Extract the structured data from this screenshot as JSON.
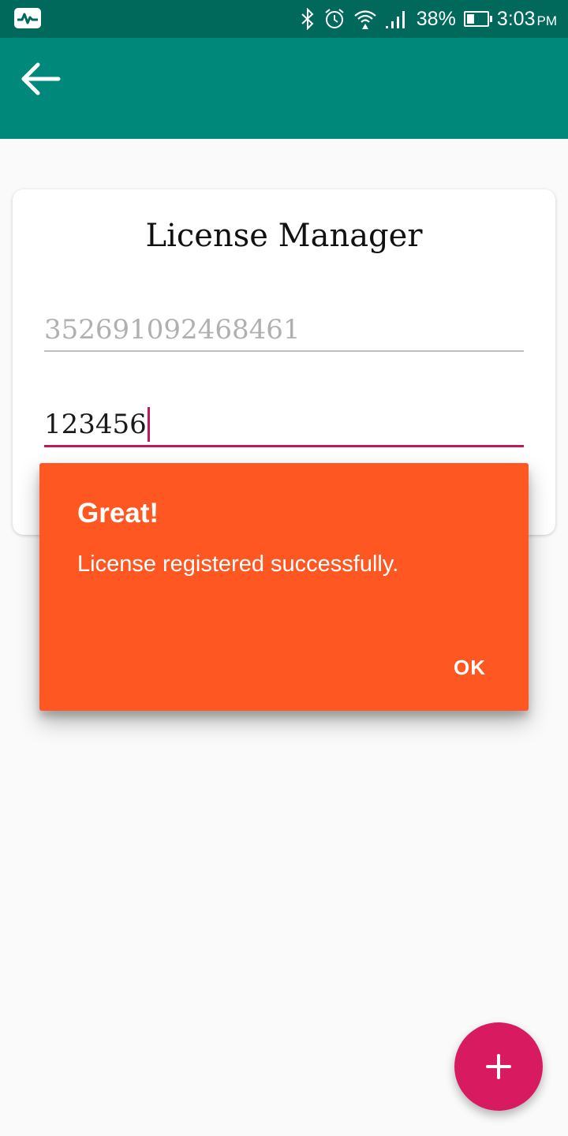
{
  "status_bar": {
    "battery_percent": "38%",
    "battery_level": 0.38,
    "time": "3:03",
    "time_suffix": "PM",
    "icons": [
      "app-notification-icon",
      "bluetooth-icon",
      "alarm-icon",
      "wifi-icon",
      "cell-signal-icon",
      "battery-icon"
    ]
  },
  "app_bar": {
    "back_icon": "arrow-left-icon",
    "color": "#00897b"
  },
  "card": {
    "title": "License Manager",
    "device_id_field": {
      "value": "352691092468461"
    },
    "license_field": {
      "value": "123456"
    }
  },
  "dialog": {
    "title": "Great!",
    "message": "License registered successfully.",
    "ok_label": "OK",
    "color": "#ff5722"
  },
  "fab": {
    "icon": "plus-icon",
    "color": "#d81b60"
  },
  "colors": {
    "status_bar": "#00695c",
    "accent": "#c2185b"
  }
}
